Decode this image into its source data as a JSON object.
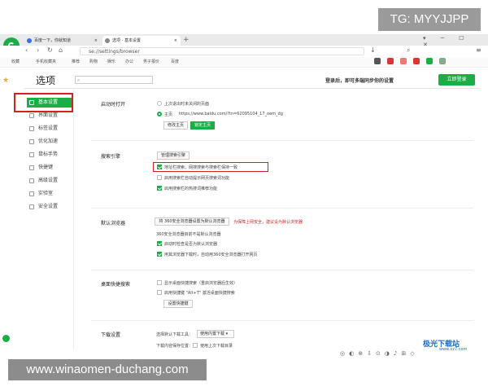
{
  "watermark": {
    "top": "TG: MYYJJPP",
    "bottom": "www.winaomen-duchang.com"
  },
  "tabs": [
    {
      "label": "百度一下，你就知道",
      "close": "×"
    },
    {
      "label": "选项 - 基本设置",
      "close": "×"
    }
  ],
  "new_tab": "+",
  "address": "se://settings/browser",
  "bookmarks": [
    "收藏",
    "手机收藏夹",
    "推荐",
    "购物",
    "娱乐",
    "办公",
    "男子报价",
    "百度"
  ],
  "page_title": "选项",
  "search_placeholder": "",
  "login_hint": "登录后，即可多端同步你的设置",
  "login_button": "立即登录",
  "sidebar": [
    {
      "label": "基本设置",
      "active": true
    },
    {
      "label": "界面设置"
    },
    {
      "label": "标签设置"
    },
    {
      "label": "优化加速"
    },
    {
      "label": "鼠标手势"
    },
    {
      "label": "快捷键"
    },
    {
      "label": "高级设置"
    },
    {
      "label": "实验室"
    },
    {
      "label": "安全设置"
    }
  ],
  "startup": {
    "title": "启动时打开",
    "opt1": "上次退出时未关闭的页面",
    "opt2": "主页",
    "home_url": "https://www.baidu.com/?tn=62095104_17_oem_dg",
    "btn_modify": "修改主页",
    "btn_locked": "锁定主页"
  },
  "search": {
    "title": "搜索引擎",
    "btn_manage": "管理搜索引擎",
    "opt1": "地址栏搜索、网搜搜索与搜索栏保持一致",
    "opt2": "启用搜索栏自动提示网页搜索词功能",
    "opt3": "启用搜索栏的热搜词推荐功能"
  },
  "default_browser": {
    "title": "默认浏览器",
    "btn": "将 360安全浏览器设置为默认浏览器",
    "warn": "为保障上网安全，建议设为默认浏览器",
    "note": "360安全浏览器目前不是默认浏览器",
    "opt1": "启动时检查是否为默认浏览器",
    "opt2": "用其浏览器下载时，自动用360安全浏览器打开网页"
  },
  "desktop": {
    "title": "桌面快捷搜索",
    "opt1": "显示桌面快捷搜索（重启浏览器后生效）",
    "opt2": "启用快捷键 \"Alt+T\" 激活桌面快捷搜索",
    "btn": "设置快捷键"
  },
  "download": {
    "title": "下载设置",
    "label": "选择默认下载工具：",
    "select": "使用内置下载",
    "path_label": "下载内容保存位置：",
    "path_opt": "使用上次下载目录"
  },
  "site_logo": {
    "name": "极光下载站",
    "sub": "www.xz7.com"
  }
}
